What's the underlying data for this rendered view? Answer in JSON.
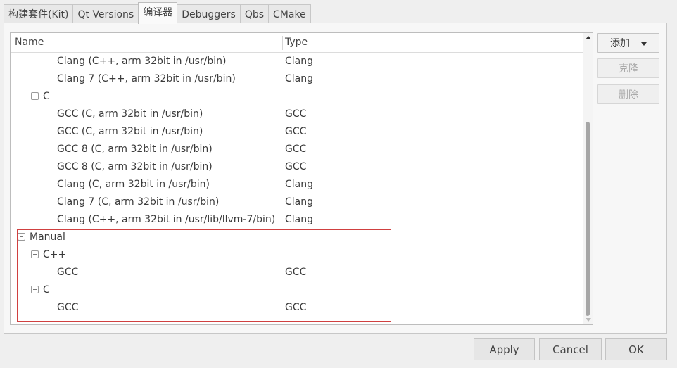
{
  "tabs": [
    {
      "label": "构建套件(Kit)"
    },
    {
      "label": "Qt Versions"
    },
    {
      "label": "编译器",
      "active": true
    },
    {
      "label": "Debuggers"
    },
    {
      "label": "Qbs"
    },
    {
      "label": "CMake"
    }
  ],
  "table": {
    "columns": {
      "name": "Name",
      "type": "Type"
    },
    "rows": [
      {
        "name": "Clang (C++, arm 32bit in /usr/bin)",
        "type": "Clang"
      },
      {
        "name": "Clang 7 (C++, arm 32bit in /usr/bin)",
        "type": "Clang"
      },
      {
        "name": "C",
        "type": ""
      },
      {
        "name": "GCC (C, arm 32bit in /usr/bin)",
        "type": "GCC"
      },
      {
        "name": "GCC (C, arm 32bit in /usr/bin)",
        "type": "GCC"
      },
      {
        "name": "GCC 8 (C, arm 32bit in /usr/bin)",
        "type": "GCC"
      },
      {
        "name": "GCC 8 (C, arm 32bit in /usr/bin)",
        "type": "GCC"
      },
      {
        "name": "Clang (C, arm 32bit in /usr/bin)",
        "type": "Clang"
      },
      {
        "name": "Clang 7 (C, arm 32bit in /usr/bin)",
        "type": "Clang"
      },
      {
        "name": "Clang (C++, arm 32bit in /usr/lib/llvm-7/bin)",
        "type": "Clang"
      },
      {
        "name": "Manual",
        "type": ""
      },
      {
        "name": "C++",
        "type": ""
      },
      {
        "name": "GCC",
        "type": "GCC"
      },
      {
        "name": "C",
        "type": ""
      },
      {
        "name": "GCC",
        "type": "GCC"
      }
    ]
  },
  "side_buttons": {
    "add": "添加",
    "clone": "克隆",
    "remove": "删除"
  },
  "bottom_buttons": {
    "apply": "Apply",
    "cancel": "Cancel",
    "ok": "OK"
  },
  "colors": {
    "highlight_border": "#d04040"
  }
}
